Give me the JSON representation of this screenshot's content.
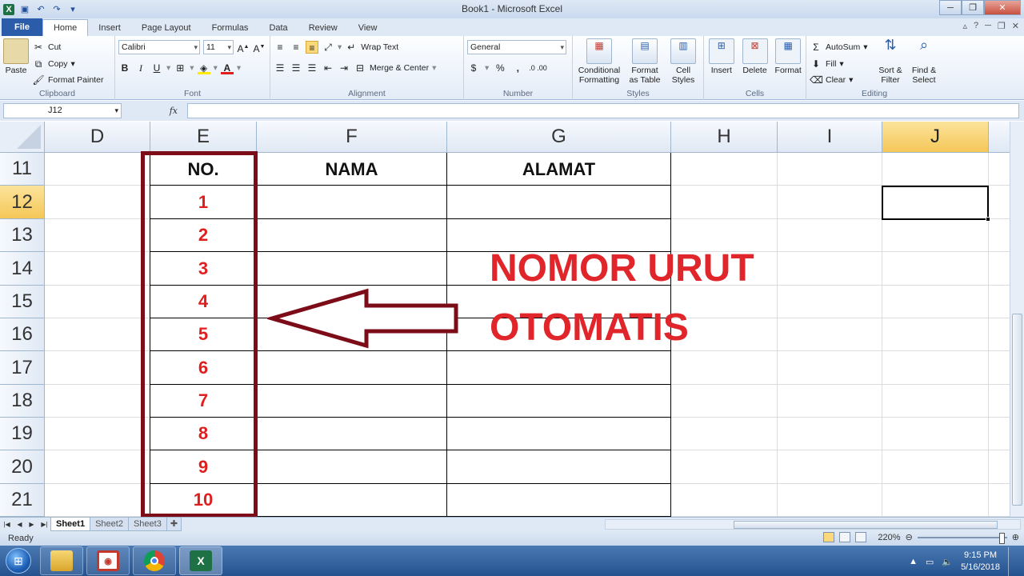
{
  "window": {
    "title": "Book1  -  Microsoft Excel"
  },
  "ribbon_tabs": [
    "File",
    "Home",
    "Insert",
    "Page Layout",
    "Formulas",
    "Data",
    "Review",
    "View"
  ],
  "ribbon": {
    "clipboard": {
      "paste": "Paste",
      "cut": "Cut",
      "copy": "Copy",
      "format_painter": "Format Painter",
      "label": "Clipboard"
    },
    "font": {
      "name": "Calibri",
      "size": "11",
      "bold": "B",
      "italic": "I",
      "underline": "U",
      "label": "Font"
    },
    "alignment": {
      "wrap": "Wrap Text",
      "merge": "Merge & Center",
      "label": "Alignment"
    },
    "number": {
      "format": "General",
      "currency": "$",
      "percent": "%",
      "comma": ",",
      "inc_dec": ".0 .00",
      "label": "Number"
    },
    "styles": {
      "conditional": "Conditional Formatting",
      "format_table": "Format as Table",
      "cell_styles": "Cell Styles",
      "label": "Styles"
    },
    "cells": {
      "insert": "Insert",
      "delete": "Delete",
      "format": "Format",
      "label": "Cells"
    },
    "editing": {
      "autosum": "AutoSum",
      "fill": "Fill",
      "clear": "Clear",
      "sort": "Sort & Filter",
      "find": "Find & Select",
      "label": "Editing"
    }
  },
  "formula_bar": {
    "name_box": "J12",
    "fx": "fx",
    "content": ""
  },
  "columns": [
    "D",
    "E",
    "F",
    "G",
    "H",
    "I",
    "J"
  ],
  "rows": [
    "11",
    "12",
    "13",
    "14",
    "15",
    "16",
    "17",
    "18",
    "19",
    "20",
    "21"
  ],
  "table": {
    "headers": [
      "NO.",
      "NAMA",
      "ALAMAT"
    ],
    "numbers": [
      "1",
      "2",
      "3",
      "4",
      "5",
      "6",
      "7",
      "8",
      "9",
      "10"
    ]
  },
  "annotation": {
    "line1": "NOMOR URUT",
    "line2": "OTOMATIS"
  },
  "sheets": [
    "Sheet1",
    "Sheet2",
    "Sheet3"
  ],
  "status": {
    "mode": "Ready",
    "zoom": "220%"
  },
  "taskbar": {
    "time": "9:15 PM",
    "date": "5/16/2018"
  },
  "colors": {
    "accent": "#e0262a",
    "box": "#7b0c18",
    "excel_green": "#1e7145"
  }
}
